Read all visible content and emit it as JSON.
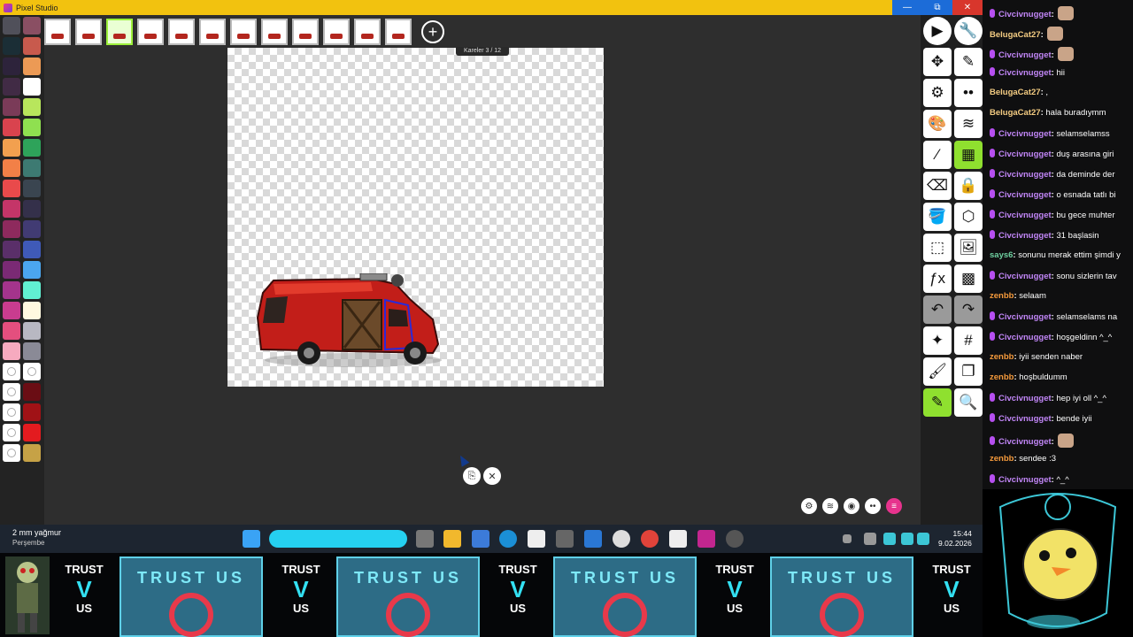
{
  "window": {
    "title": "Pixel Studio",
    "minimize": "—",
    "restore": "⧉",
    "close": "✕"
  },
  "canvas": {
    "frame_label": "Kareler 3 / 12",
    "frame_count": 12,
    "active_frame": 3
  },
  "palette": {
    "colors": [
      "#50505a",
      "#8a4f63",
      "#1b2e36",
      "#c85a4d",
      "#2d233b",
      "#ec9a55",
      "#412b45",
      "#ffffff",
      "#7a3b58",
      "#b8e65c",
      "#d9434e",
      "#8fe050",
      "#f2a04f",
      "#2ea35a",
      "#f28047",
      "#3d7a72",
      "#e94a4b",
      "#3a4550",
      "#c43568",
      "#34304a",
      "#8e2a5d",
      "#413b73",
      "#5a2f69",
      "#3f5ab8",
      "#7a2a74",
      "#4ba6ef",
      "#a4348c",
      "#61f0d2",
      "#c93c8f",
      "#fff9e0",
      "#e44f7e",
      "#b8b8c2",
      "#f6aabf",
      "#8a8a96"
    ],
    "dark_red": "#6a0d14",
    "red": "#a01216",
    "bright_red": "#e31b1f",
    "olive": "#c6a246"
  },
  "tools": {
    "icons": [
      "play-icon",
      "wrench-icon",
      "move-icon",
      "pencil-icon",
      "settings-icon",
      "more-icon",
      "palette-icon",
      "layers-icon",
      "eyedropper-icon",
      "film-icon",
      "eraser-icon",
      "bucket-lock-icon",
      "bucket-icon",
      "hexagon-icon",
      "crop-icon",
      "image-icon",
      "function-icon",
      "dither-icon",
      "undo-icon",
      "redo-icon",
      "magic-wand-icon",
      "grid-icon",
      "brush-icon",
      "frames-icon",
      "pen-icon",
      "zoom-icon"
    ],
    "glyphs": [
      "▶",
      "🔧",
      "✥",
      "✎",
      "⚙",
      "••",
      "🎨",
      "≋",
      "⁄",
      "▦",
      "⌫",
      "🔒",
      "🪣",
      "⬡",
      "⬚",
      "🖼",
      "ƒx",
      "▩",
      "↶",
      "↷",
      "✦",
      "#",
      "🖌",
      "❐",
      "✎",
      "🔍"
    ]
  },
  "chat": {
    "messages": [
      {
        "user": "Civcivnugget",
        "text": "",
        "emote": true,
        "badge": true,
        "color": "purple"
      },
      {
        "user": "BelugaCat27",
        "text": "",
        "emote": true,
        "badge": false,
        "color": "beige"
      },
      {
        "user": "Civcivnugget",
        "text": "",
        "emote": true,
        "badge": true,
        "color": "purple"
      },
      {
        "user": "Civcivnugget",
        "text": "hii",
        "emote": false,
        "badge": true,
        "color": "purple"
      },
      {
        "user": "BelugaCat27",
        "text": ",",
        "emote": false,
        "badge": false,
        "color": "beige"
      },
      {
        "user": "BelugaCat27",
        "text": "hala buradıymm",
        "emote": false,
        "badge": false,
        "color": "beige"
      },
      {
        "user": "Civcivnugget",
        "text": "selamselamss",
        "emote": false,
        "badge": true,
        "color": "purple"
      },
      {
        "user": "Civcivnugget",
        "text": "duş arasına giri",
        "emote": false,
        "badge": true,
        "color": "purple"
      },
      {
        "user": "Civcivnugget",
        "text": "da deminde der",
        "emote": false,
        "badge": true,
        "color": "purple"
      },
      {
        "user": "Civcivnugget",
        "text": "o esnada tatlı bi",
        "emote": false,
        "badge": true,
        "color": "purple"
      },
      {
        "user": "Civcivnugget",
        "text": "bu gece muhter",
        "emote": false,
        "badge": true,
        "color": "purple"
      },
      {
        "user": "Civcivnugget",
        "text": "31 başlasin",
        "emote": false,
        "badge": true,
        "color": "purple"
      },
      {
        "user": "says6",
        "text": "sonunu merak ettim şimdi y",
        "emote": false,
        "badge": false,
        "color": "green"
      },
      {
        "user": "Civcivnugget",
        "text": "sonu sizlerin tav",
        "emote": false,
        "badge": true,
        "color": "purple"
      },
      {
        "user": "zenbb",
        "text": "selaam",
        "emote": false,
        "badge": false,
        "color": "orange"
      },
      {
        "user": "Civcivnugget",
        "text": "selamselams na",
        "emote": false,
        "badge": true,
        "color": "purple"
      },
      {
        "user": "Civcivnugget",
        "text": "hoşgeldinn ^_^",
        "emote": false,
        "badge": true,
        "color": "purple"
      },
      {
        "user": "zenbb",
        "text": "iyii senden naber",
        "emote": false,
        "badge": false,
        "color": "orange"
      },
      {
        "user": "zenbb",
        "text": "hoşbuldumm",
        "emote": false,
        "badge": false,
        "color": "orange"
      },
      {
        "user": "Civcivnugget",
        "text": "hep iyi oll ^_^",
        "emote": false,
        "badge": true,
        "color": "purple"
      },
      {
        "user": "Civcivnugget",
        "text": "bende iyii",
        "emote": false,
        "badge": true,
        "color": "purple"
      },
      {
        "user": "Civcivnugget",
        "text": "",
        "emote": true,
        "badge": true,
        "color": "purple"
      },
      {
        "user": "zenbb",
        "text": "sendee :3",
        "emote": false,
        "badge": false,
        "color": "orange"
      },
      {
        "user": "Civcivnugget",
        "text": "^_^",
        "emote": false,
        "badge": true,
        "color": "purple"
      }
    ]
  },
  "taskbar": {
    "weather_temp": "2 mm yağmur",
    "weather_day": "Perşembe",
    "time": "15:44",
    "date": "9.02.2026"
  },
  "banner": {
    "logo_top": "TRUST",
    "logo_bottom": "US",
    "tile_text": "TRUST US"
  }
}
